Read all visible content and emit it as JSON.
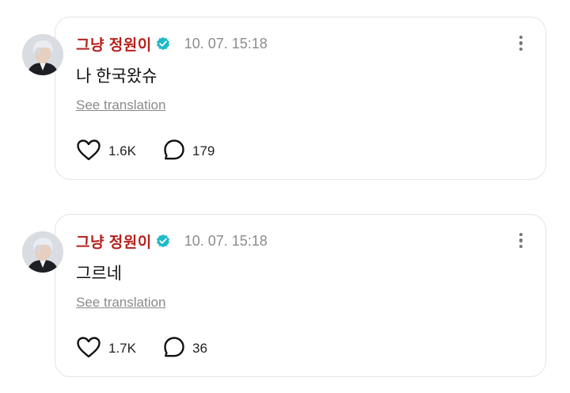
{
  "posts": [
    {
      "author": "그냥 정원이",
      "date": "10. 07. 15:18",
      "text": "나 한국왔슈",
      "translate_label": "See translation",
      "likes": "1.6K",
      "comments": "179"
    },
    {
      "author": "그냥 정원이",
      "date": "10. 07. 15:18",
      "text": "그르네",
      "translate_label": "See translation",
      "likes": "1.7K",
      "comments": "36"
    }
  ],
  "colors": {
    "author": "#b5211c",
    "verified": "#1fb9c8",
    "muted": "#8c8c8c",
    "border": "#e4e4e4"
  },
  "icons": {
    "verified": "verified-badge-icon",
    "like": "heart-outline-icon",
    "comment": "speech-bubble-icon",
    "more": "more-vertical-icon"
  }
}
